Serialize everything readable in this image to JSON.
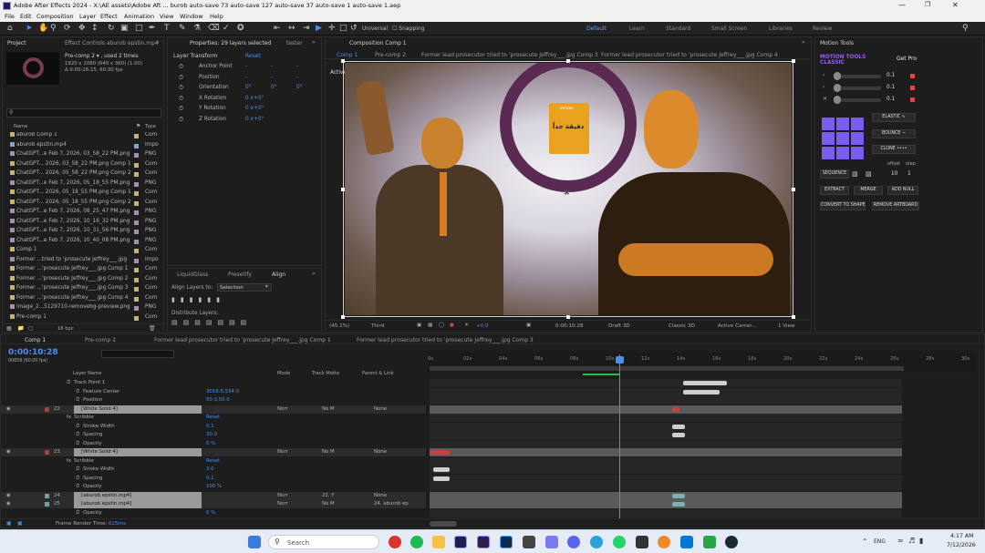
{
  "titlebar": {
    "title": "Adobe After Effects 2024 - X:\\AE assets\\Adobe Aft ... burob auto-save 73 auto-save 127 auto-save 37 auto-save 1 auto-save 1.aep"
  },
  "menu": [
    "File",
    "Edit",
    "Composition",
    "Layer",
    "Effect",
    "Animation",
    "View",
    "Window",
    "Help"
  ],
  "toolbar": {
    "universal": "Universal",
    "snapping": "Snapping"
  },
  "workspaces": [
    "Default",
    "Learn",
    "Standard",
    "Small Screen",
    "Libraries",
    "Review"
  ],
  "workspace_active": "Default",
  "project": {
    "tab": "Project",
    "tab2": "Effect Controls aburob epstin.mp4",
    "info_name": "Pre-comp 2 ▾ , used 2 times",
    "info_dims": "1920 x 1080 (640 x 360) (1.00)",
    "info_dur": "Δ 0:00:26:15, 60.00 fps",
    "col_name": "Name",
    "col_type": "Type",
    "items": [
      {
        "name": "aburob Comp 1",
        "type": "Com",
        "icon": "comp",
        "color": "#c9b26a"
      },
      {
        "name": "aburob epstin.mp4",
        "type": "Impo",
        "icon": "footage",
        "color": "#8aa3c7"
      },
      {
        "name": "ChatGPT...e Feb 7, 2026, 03_58_22 PM.png",
        "type": "PNG",
        "icon": "image",
        "color": "#a58cb5"
      },
      {
        "name": "ChatGPT... 2026, 03_58_22 PM.png Comp 1",
        "type": "Com",
        "icon": "comp",
        "color": "#c9b26a"
      },
      {
        "name": "ChatGPT... 2026, 05_58_22 PM.png Comp 2",
        "type": "Com",
        "icon": "comp",
        "color": "#c9b26a"
      },
      {
        "name": "ChatGPT...e Feb 7, 2026, 05_18_55 PM.png",
        "type": "PNG",
        "icon": "image",
        "color": "#a58cb5"
      },
      {
        "name": "ChatGPT... 2026, 05_18_55 PM.png Comp 1",
        "type": "Com",
        "icon": "comp",
        "color": "#c9b26a"
      },
      {
        "name": "ChatGPT... 2026, 05_18_55 PM.png Comp 2",
        "type": "Com",
        "icon": "comp",
        "color": "#c9b26a"
      },
      {
        "name": "ChatGPT...e Feb 7, 2026, 08_25_47 PM.png",
        "type": "PNG",
        "icon": "image",
        "color": "#a58cb5"
      },
      {
        "name": "ChatGPT...e Feb 7, 2026, 10_16_32 PM.png",
        "type": "PNG",
        "icon": "image",
        "color": "#a58cb5"
      },
      {
        "name": "ChatGPT...e Feb 7, 2026, 10_31_56 PM.png",
        "type": "PNG",
        "icon": "image",
        "color": "#a58cb5"
      },
      {
        "name": "ChatGPT...e Feb 7, 2026, 10_40_08 PM.png",
        "type": "PNG",
        "icon": "image",
        "color": "#a58cb5"
      },
      {
        "name": "Comp 1",
        "type": "Com",
        "icon": "comp",
        "color": "#c9b26a"
      },
      {
        "name": "Former ...tried to 'prosecute Jeffrey___.jpg",
        "type": "Impo",
        "icon": "image",
        "color": "#a58cb5"
      },
      {
        "name": "Former ...'prosecute Jeffrey___.jpg Comp 1",
        "type": "Com",
        "icon": "comp",
        "color": "#c9b26a"
      },
      {
        "name": "Former ...'prosecute Jeffrey___.jpg Comp 2",
        "type": "Com",
        "icon": "comp",
        "color": "#c9b26a"
      },
      {
        "name": "Former ...'prosecute Jeffrey___.jpg Comp 3",
        "type": "Com",
        "icon": "comp",
        "color": "#c9b26a"
      },
      {
        "name": "Former ...'prosecute Jeffrey___.jpg Comp 4",
        "type": "Com",
        "icon": "comp",
        "color": "#c9b26a"
      },
      {
        "name": "image_2...5129710-removebg-preview.png",
        "type": "PNG",
        "icon": "image",
        "color": "#a58cb5"
      },
      {
        "name": "Pre-comp 1",
        "type": "Com",
        "icon": "comp",
        "color": "#c9b26a"
      }
    ],
    "footer_bpc": "16 bpc"
  },
  "properties": {
    "tab": "Properties: 29 layers selected",
    "tab2": "tester",
    "section": "Layer Transform",
    "reset": "Reset",
    "rows": [
      {
        "label": "Anchor Point",
        "values": [
          "-",
          "-",
          "-"
        ]
      },
      {
        "label": "Position",
        "values": [
          "-",
          "-",
          "-"
        ]
      },
      {
        "label": "Orientation",
        "values": [
          "0°",
          "0°",
          "0°"
        ]
      },
      {
        "label": "X Rotation",
        "values": [
          "0 x+0°"
        ]
      },
      {
        "label": "Y Rotation",
        "values": [
          "0 x+0°"
        ]
      },
      {
        "label": "Z Rotation",
        "values": [
          "0 x+0°"
        ]
      }
    ]
  },
  "align": {
    "tabs": [
      "LiquidGlass",
      "Presetify",
      "Align"
    ],
    "active_tab": "Align",
    "align_to_label": "Align Layers to:",
    "align_to_value": "Selection",
    "distribute_label": "Distribute Layers:"
  },
  "viewer": {
    "tab": "Composition Comp 1",
    "subtabs": [
      "Comp 1",
      "Pre-comp 2",
      "Former lead prosecutor tried to 'prosecute Jeffrey___.jpg Comp 3",
      "Former lead prosecutor tried to 'prosecute Jeffrey___.jpg Comp 4"
    ],
    "camera_label": "Active Camera (Default)",
    "sign_top": "Verizon",
    "sign_text": "دقيقة جداً",
    "footer": {
      "zoom": "(45.1%)",
      "resolution": "Third",
      "exposure": "+0.0",
      "timecode": "0:00:10:28",
      "draft": "Draft 3D",
      "renderer": "Classic 3D",
      "camera": "Active Camer...",
      "views": "1 View"
    }
  },
  "motion_tools": {
    "tab": "Motion Tools",
    "title": "MOTION TOOLS CLASSIC",
    "get_pro": "Get Pro",
    "sliders": [
      "0.1",
      "0.1",
      "0.1"
    ],
    "elastic": "ELASTIC",
    "bounce": "BOUNCE",
    "clone": "CLONE",
    "offset_label": "offset",
    "step_label": "step",
    "sequence": "SEQUENCE",
    "offset_value": "10",
    "step_value": "1",
    "extract": "EXTRACT",
    "merge": "MERGE",
    "add_null": "ADD NULL",
    "convert": "CONVERT TO SHAPE",
    "remove_artboard": "REMOVE ARTBOARD"
  },
  "timeline": {
    "tabs": [
      "Comp 1",
      "Pre-comp 2",
      "Former lead prosecutor tried to 'prosecute Jeffrey___.jpg Comp 1",
      "Former lead prosecutor tried to 'prosecute Jeffrey___.jpg Comp 3"
    ],
    "timecode": "0:00:10:28",
    "timecode_sub": "00658 (60.00 fps)",
    "col_headers": {
      "layer_name": "Layer Name",
      "mode": "Mode",
      "track_matte": "Track Matte",
      "parent": "Parent & Link"
    },
    "ruler": [
      "0s",
      "02s",
      "04s",
      "06s",
      "08s",
      "10s",
      "12s",
      "14s",
      "16s",
      "18s",
      "20s",
      "22s",
      "24s",
      "26s",
      "28s",
      "30s"
    ],
    "rows": [
      {
        "kind": "prop",
        "indent": 1,
        "label": "Track Point 1",
        "value": ""
      },
      {
        "kind": "prop",
        "indent": 2,
        "label": "Feature Center",
        "value": "3018.0,534.0"
      },
      {
        "kind": "prop",
        "indent": 2,
        "label": "Position",
        "value": "50.0,50.0"
      },
      {
        "kind": "layer",
        "num": "22",
        "label": "[White Solid 4]",
        "mode": "Norr",
        "matte": "No M",
        "parent": "None",
        "color": "#b03a3a"
      },
      {
        "kind": "fx",
        "indent": 1,
        "label": "Scribble",
        "value": "Reset"
      },
      {
        "kind": "prop",
        "indent": 2,
        "label": "Stroke Width",
        "value": "0.1"
      },
      {
        "kind": "prop",
        "indent": 2,
        "label": "Spacing",
        "value": "30.0"
      },
      {
        "kind": "prop",
        "indent": 2,
        "label": "Opacity",
        "value": "0 %"
      },
      {
        "kind": "layer",
        "num": "23",
        "label": "[White Solid 4]",
        "mode": "Norr",
        "matte": "No M",
        "parent": "None",
        "color": "#b03a3a"
      },
      {
        "kind": "fx",
        "indent": 1,
        "label": "Scribble",
        "value": "Reset"
      },
      {
        "kind": "prop",
        "indent": 2,
        "label": "Stroke Width",
        "value": "3.0"
      },
      {
        "kind": "prop",
        "indent": 2,
        "label": "Spacing",
        "value": "0.1"
      },
      {
        "kind": "prop",
        "indent": 2,
        "label": "Opacity",
        "value": "100 %"
      },
      {
        "kind": "layer",
        "num": "24",
        "label": "[aburob epstin.mp4]",
        "mode": "Norr",
        "matte": "22. Y",
        "parent": "None",
        "color": "#6aa3a3"
      },
      {
        "kind": "layer",
        "num": "25",
        "label": "[aburob epstin.mp4]",
        "mode": "Norr",
        "matte": "No M",
        "parent": "24. aburob ep",
        "color": "#6aa3a3"
      },
      {
        "kind": "prop",
        "indent": 2,
        "label": "Opacity",
        "value": "0 %"
      }
    ],
    "footer_render": "Frame Render Time:",
    "footer_render_value": "625ms"
  },
  "taskbar": {
    "search_placeholder": "Search",
    "lang": "ENG",
    "time": "4:17 AM",
    "date": "7/12/2026"
  }
}
